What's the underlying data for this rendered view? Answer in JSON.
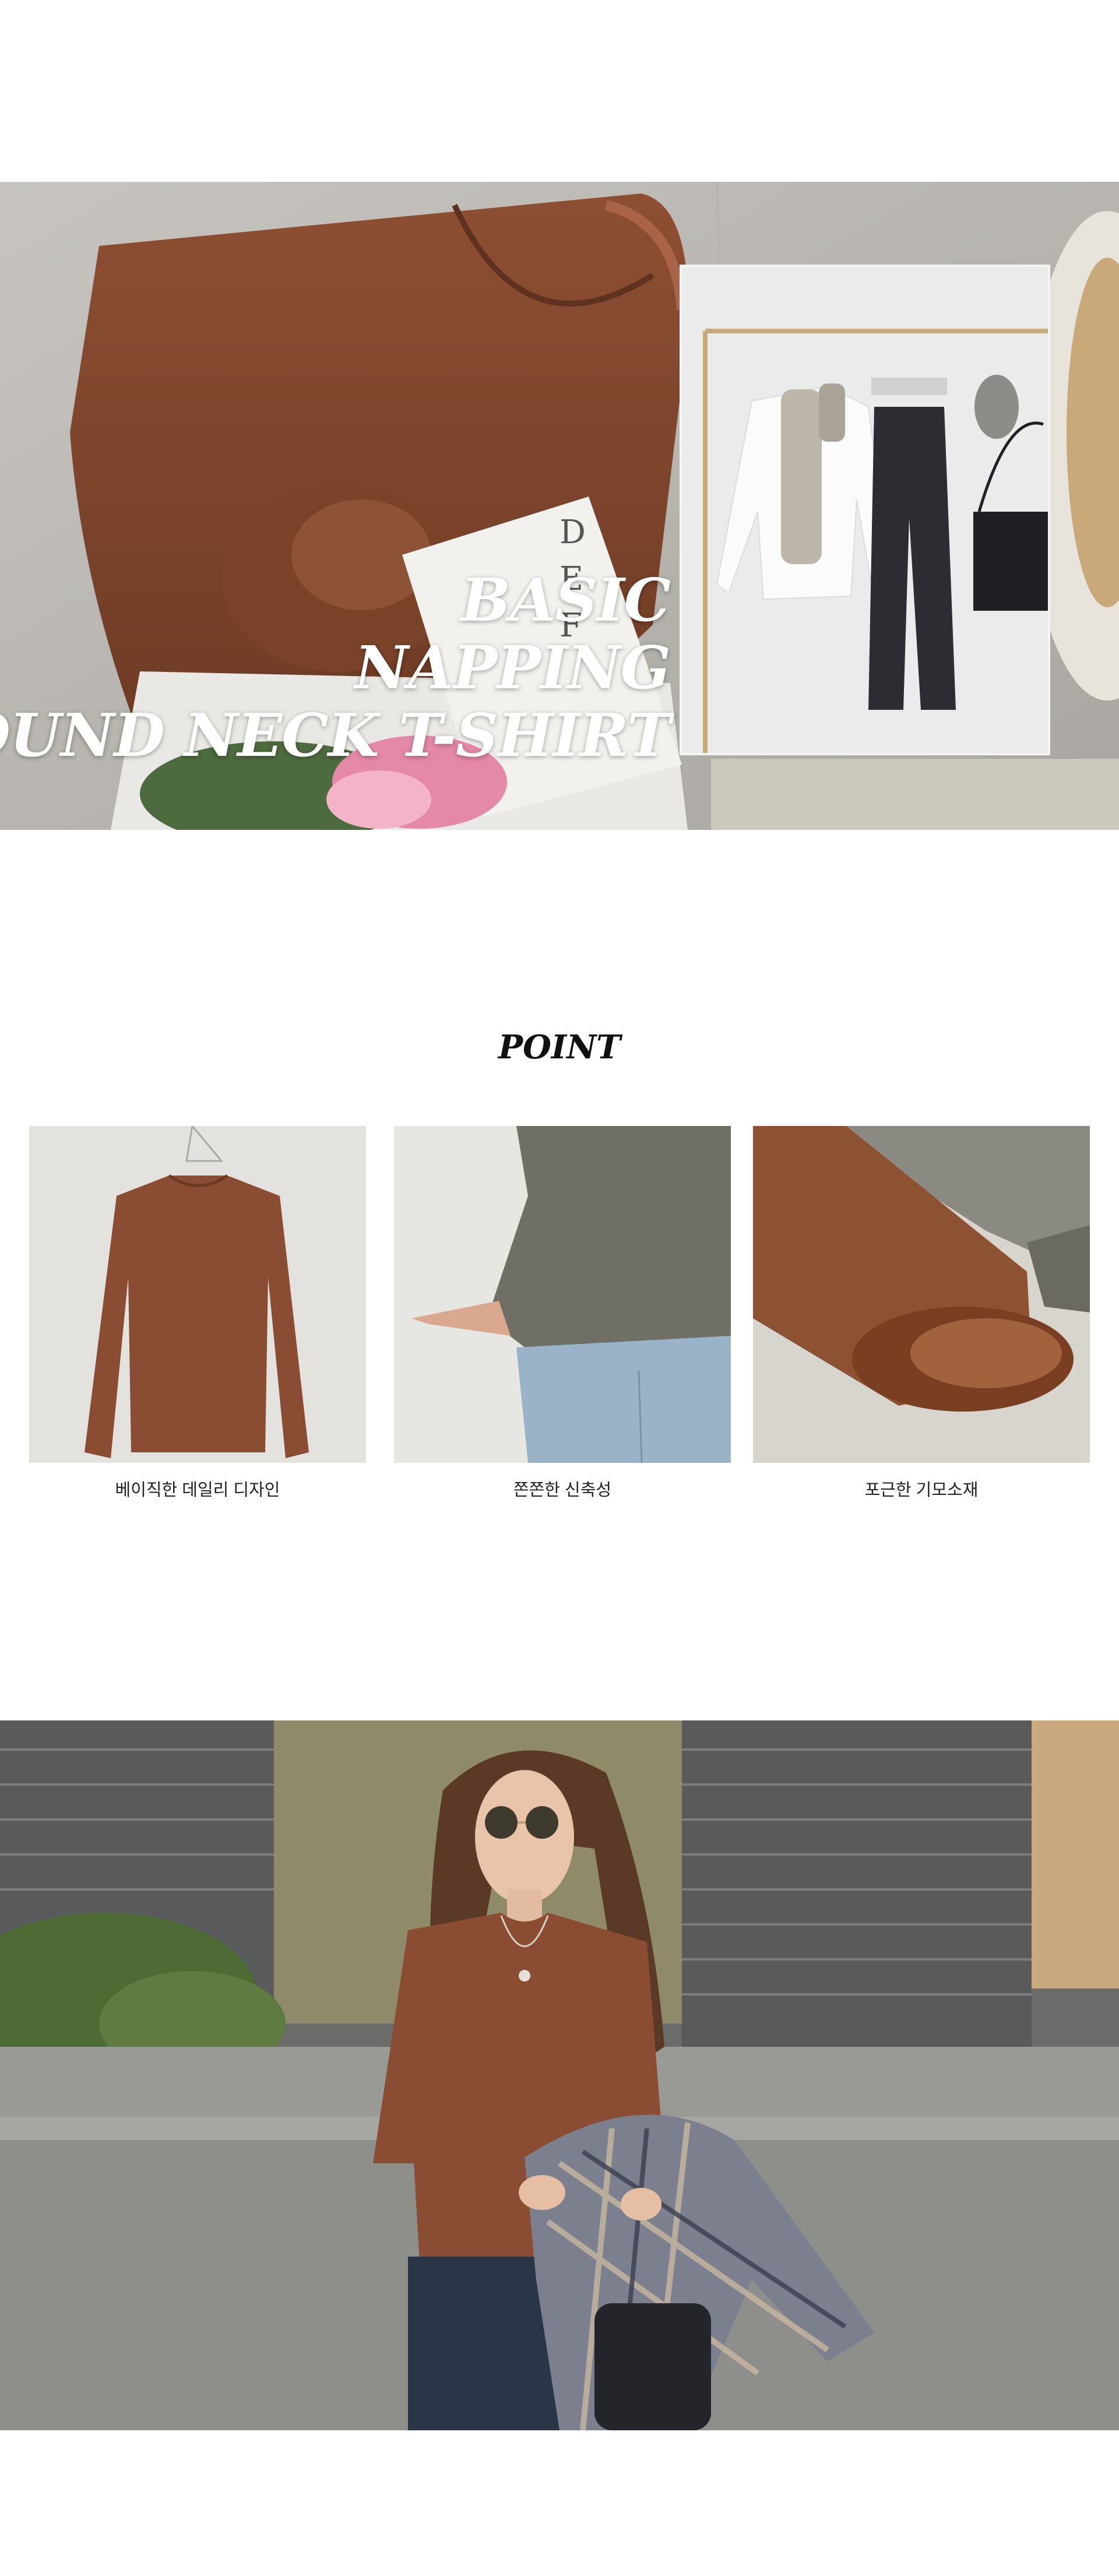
{
  "hero": {
    "title_lines": [
      "BASIC",
      "NAPPING",
      "ROUND NECK T-SHIRT"
    ],
    "book_cover_letters": "D\nE\nF"
  },
  "point": {
    "heading": "POINT",
    "items": [
      {
        "caption": "베이직한 데일리 디자인"
      },
      {
        "caption": "쫀쫀한 신축성"
      },
      {
        "caption": "포근한 기모소재"
      }
    ]
  },
  "colors": {
    "shirt_brown": "#8a4d33",
    "shirt_khaki": "#6f6f66",
    "denim": "#9bb3c9",
    "background": "#ffffff"
  }
}
